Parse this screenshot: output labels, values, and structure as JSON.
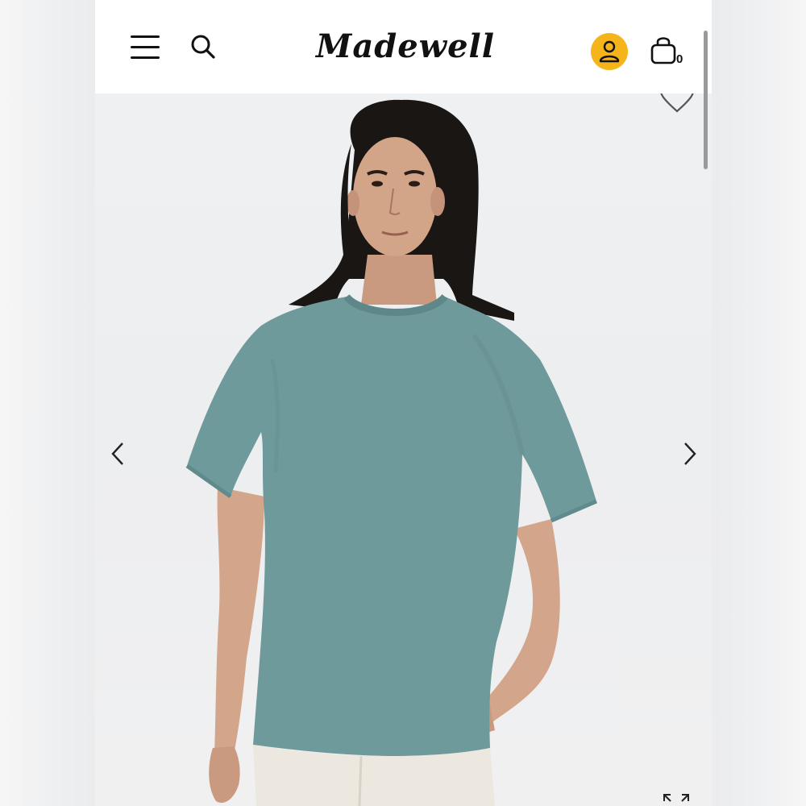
{
  "header": {
    "logo_text": "Madewell",
    "bag_count": "0",
    "account_color": "#f4b41a"
  },
  "hero": {
    "product_color": "#6f9a9b",
    "icons": [
      "menu-icon",
      "search-icon",
      "user-icon",
      "shopping-bag-icon",
      "heart-icon",
      "chevron-left-icon",
      "chevron-right-icon",
      "expand-icon"
    ]
  }
}
